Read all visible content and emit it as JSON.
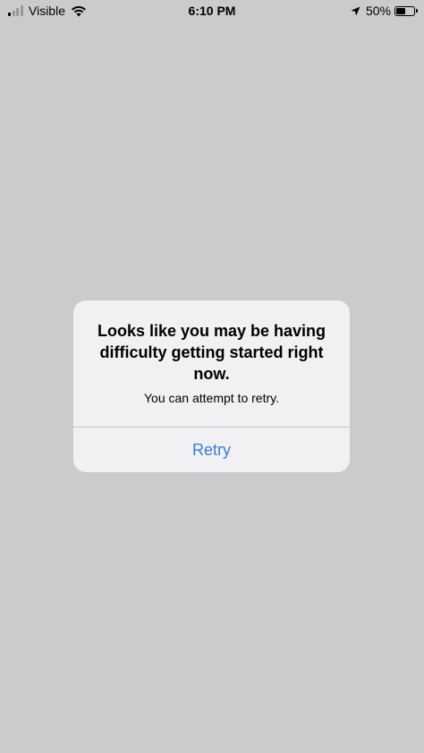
{
  "status_bar": {
    "carrier": "Visible",
    "time": "6:10 PM",
    "battery_percent": "50%",
    "battery_level": 0.5,
    "signal_bars_total": 4,
    "signal_bars_active": 1
  },
  "alert": {
    "title": "Looks like you may be having difficulty getting started right now.",
    "message": "You can attempt to retry.",
    "button_label": "Retry"
  },
  "colors": {
    "background": "#cbcbcb",
    "alert_background": "#f1f1f4",
    "button_text": "#3a7bd5"
  },
  "icons": [
    "signal-icon",
    "wifi-icon",
    "location-arrow-icon",
    "battery-icon"
  ]
}
